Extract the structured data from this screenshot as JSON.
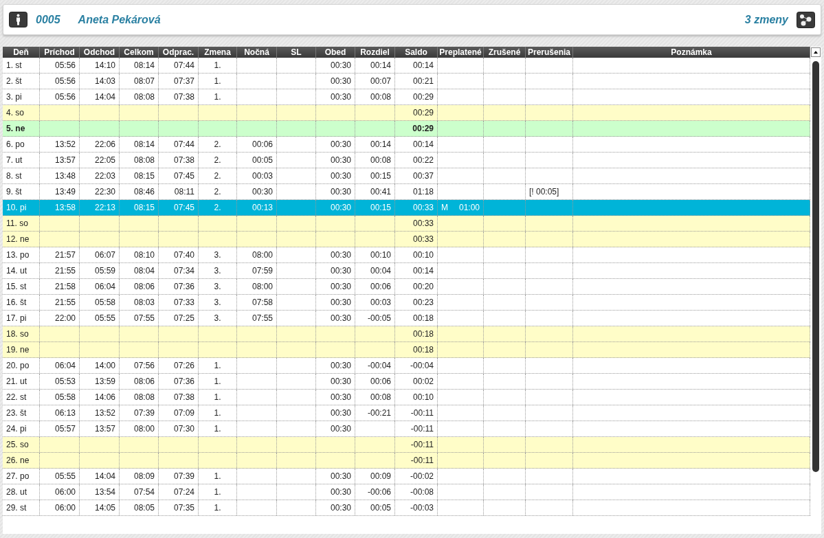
{
  "header": {
    "employee_id": "0005",
    "employee_name": "Aneta Pekárová",
    "shift_mode": "3 zmeny"
  },
  "table": {
    "columns": [
      "Deň",
      "Príchod",
      "Odchod",
      "Celkom",
      "Odprac.",
      "Zmena",
      "Nočná",
      "SL",
      "Obed",
      "Rozdiel",
      "Saldo",
      "Preplatené",
      "Zrušené",
      "Prerušenia",
      "Poznámka"
    ],
    "rows": [
      {
        "day": "1. st",
        "kind": "workday",
        "selected": false,
        "in": "05:56",
        "out": "14:10",
        "total": "08:14",
        "worked": "07:44",
        "shift": "1.",
        "lunch": "00:30",
        "diff": "00:14",
        "balance": "00:14"
      },
      {
        "day": "2. št",
        "kind": "workday",
        "selected": false,
        "in": "05:56",
        "out": "14:03",
        "total": "08:07",
        "worked": "07:37",
        "shift": "1.",
        "lunch": "00:30",
        "diff": "00:07",
        "balance": "00:21"
      },
      {
        "day": "3. pi",
        "kind": "workday",
        "selected": false,
        "in": "05:56",
        "out": "14:04",
        "total": "08:08",
        "worked": "07:38",
        "shift": "1.",
        "lunch": "00:30",
        "diff": "00:08",
        "balance": "00:29"
      },
      {
        "day": "4. so",
        "kind": "weekend",
        "selected": false,
        "balance": "00:29"
      },
      {
        "day": "5. ne",
        "kind": "holiday",
        "selected": false,
        "balance": "00:29"
      },
      {
        "day": "6. po",
        "kind": "workday",
        "selected": false,
        "in": "13:52",
        "out": "22:06",
        "total": "08:14",
        "worked": "07:44",
        "shift": "2.",
        "night": "00:06",
        "lunch": "00:30",
        "diff": "00:14",
        "balance": "00:14"
      },
      {
        "day": "7. ut",
        "kind": "workday",
        "selected": false,
        "in": "13:57",
        "out": "22:05",
        "total": "08:08",
        "worked": "07:38",
        "shift": "2.",
        "night": "00:05",
        "lunch": "00:30",
        "diff": "00:08",
        "balance": "00:22"
      },
      {
        "day": "8. st",
        "kind": "workday",
        "selected": false,
        "in": "13:48",
        "out": "22:03",
        "total": "08:15",
        "worked": "07:45",
        "shift": "2.",
        "night": "00:03",
        "lunch": "00:30",
        "diff": "00:15",
        "balance": "00:37"
      },
      {
        "day": "9. št",
        "kind": "workday",
        "selected": false,
        "in": "13:49",
        "out": "22:30",
        "total": "08:46",
        "worked": "08:11",
        "shift": "2.",
        "night": "00:30",
        "lunch": "00:30",
        "diff": "00:41",
        "balance": "01:18",
        "interruption": "[! 00:05]"
      },
      {
        "day": "10. pi",
        "kind": "workday",
        "selected": true,
        "in": "13:58",
        "out": "22:13",
        "total": "08:15",
        "worked": "07:45",
        "shift": "2.",
        "night": "00:13",
        "lunch": "00:30",
        "diff": "00:15",
        "balance": "00:33",
        "overpaid_mark": "M",
        "overpaid": "01:00"
      },
      {
        "day": "11. so",
        "kind": "weekend",
        "selected": false,
        "balance": "00:33"
      },
      {
        "day": "12. ne",
        "kind": "weekend",
        "selected": false,
        "balance": "00:33"
      },
      {
        "day": "13. po",
        "kind": "workday",
        "selected": false,
        "in": "21:57",
        "out": "06:07",
        "total": "08:10",
        "worked": "07:40",
        "shift": "3.",
        "night": "08:00",
        "lunch": "00:30",
        "diff": "00:10",
        "balance": "00:10"
      },
      {
        "day": "14. ut",
        "kind": "workday",
        "selected": false,
        "in": "21:55",
        "out": "05:59",
        "total": "08:04",
        "worked": "07:34",
        "shift": "3.",
        "night": "07:59",
        "lunch": "00:30",
        "diff": "00:04",
        "balance": "00:14"
      },
      {
        "day": "15. st",
        "kind": "workday",
        "selected": false,
        "in": "21:58",
        "out": "06:04",
        "total": "08:06",
        "worked": "07:36",
        "shift": "3.",
        "night": "08:00",
        "lunch": "00:30",
        "diff": "00:06",
        "balance": "00:20"
      },
      {
        "day": "16. št",
        "kind": "workday",
        "selected": false,
        "in": "21:55",
        "out": "05:58",
        "total": "08:03",
        "worked": "07:33",
        "shift": "3.",
        "night": "07:58",
        "lunch": "00:30",
        "diff": "00:03",
        "balance": "00:23"
      },
      {
        "day": "17. pi",
        "kind": "workday",
        "selected": false,
        "in": "22:00",
        "out": "05:55",
        "total": "07:55",
        "worked": "07:25",
        "shift": "3.",
        "night": "07:55",
        "lunch": "00:30",
        "diff": "-00:05",
        "balance": "00:18"
      },
      {
        "day": "18. so",
        "kind": "weekend",
        "selected": false,
        "balance": "00:18"
      },
      {
        "day": "19. ne",
        "kind": "weekend",
        "selected": false,
        "balance": "00:18"
      },
      {
        "day": "20. po",
        "kind": "workday",
        "selected": false,
        "in": "06:04",
        "out": "14:00",
        "total": "07:56",
        "worked": "07:26",
        "shift": "1.",
        "lunch": "00:30",
        "diff": "-00:04",
        "balance": "-00:04"
      },
      {
        "day": "21. ut",
        "kind": "workday",
        "selected": false,
        "in": "05:53",
        "out": "13:59",
        "total": "08:06",
        "worked": "07:36",
        "shift": "1.",
        "lunch": "00:30",
        "diff": "00:06",
        "balance": "00:02"
      },
      {
        "day": "22. st",
        "kind": "workday",
        "selected": false,
        "in": "05:58",
        "out": "14:06",
        "total": "08:08",
        "worked": "07:38",
        "shift": "1.",
        "lunch": "00:30",
        "diff": "00:08",
        "balance": "00:10"
      },
      {
        "day": "23. št",
        "kind": "workday",
        "selected": false,
        "in": "06:13",
        "out": "13:52",
        "total": "07:39",
        "worked": "07:09",
        "shift": "1.",
        "lunch": "00:30",
        "diff": "-00:21",
        "balance": "-00:11"
      },
      {
        "day": "24. pi",
        "kind": "workday",
        "selected": false,
        "in": "05:57",
        "out": "13:57",
        "total": "08:00",
        "worked": "07:30",
        "shift": "1.",
        "lunch": "00:30",
        "balance": "-00:11"
      },
      {
        "day": "25. so",
        "kind": "weekend",
        "selected": false,
        "balance": "-00:11"
      },
      {
        "day": "26. ne",
        "kind": "weekend",
        "selected": false,
        "balance": "-00:11"
      },
      {
        "day": "27. po",
        "kind": "workday",
        "selected": false,
        "in": "05:55",
        "out": "14:04",
        "total": "08:09",
        "worked": "07:39",
        "shift": "1.",
        "lunch": "00:30",
        "diff": "00:09",
        "balance": "-00:02"
      },
      {
        "day": "28. ut",
        "kind": "workday",
        "selected": false,
        "in": "06:00",
        "out": "13:54",
        "total": "07:54",
        "worked": "07:24",
        "shift": "1.",
        "lunch": "00:30",
        "diff": "-00:06",
        "balance": "-00:08"
      },
      {
        "day": "29. st",
        "kind": "workday",
        "selected": false,
        "in": "06:00",
        "out": "14:05",
        "total": "08:05",
        "worked": "07:35",
        "shift": "1.",
        "lunch": "00:30",
        "diff": "00:05",
        "balance": "-00:03"
      }
    ]
  }
}
